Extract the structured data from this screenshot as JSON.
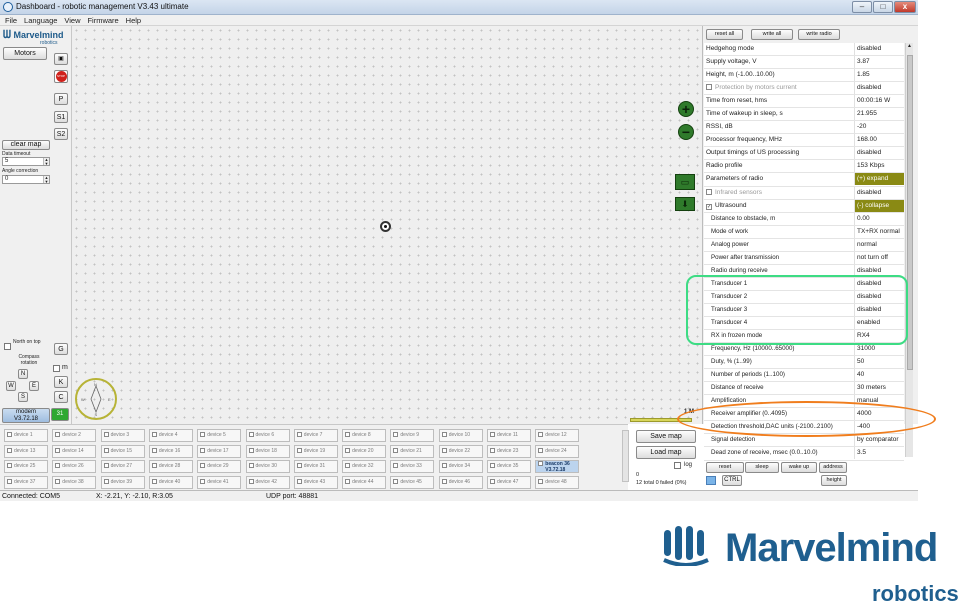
{
  "window": {
    "title": "Dashboard - robotic management  V3.43  ultimate",
    "minimize": "–",
    "maximize": "□",
    "close": "x"
  },
  "menu": [
    "File",
    "Language",
    "View",
    "Firmware",
    "Help"
  ],
  "left_panel": {
    "logo": "Marvelmind",
    "logo_sub": "robotics",
    "motors": "Motors",
    "clear_map": "clear map",
    "data_timeout_label": "Data timeout",
    "data_timeout_value": "5",
    "angle_correction_label": "Angle correction",
    "angle_correction_value": "0",
    "north_on_top": "North on top",
    "compass_rotation": "Compass rotation",
    "compass": {
      "n": "N",
      "w": "W",
      "e": "E",
      "s": "S"
    },
    "modem": "modem",
    "modem_version": "V3.72.18",
    "modem_id": "31",
    "side_buttons": {
      "stop": "STOP",
      "p": "P",
      "s1": "S1",
      "s2": "S2",
      "g": "G",
      "m": "m",
      "k": "K",
      "c": "C"
    }
  },
  "map": {
    "zoom_in": "+",
    "zoom_out": "−",
    "ruler": "1 M"
  },
  "right_panel": {
    "reset_all": "reset all",
    "write_all": "write all",
    "write_radio": "write radio",
    "properties": [
      {
        "name": "Hedgehog mode",
        "value": "disabled"
      },
      {
        "name": "Supply voltage, V",
        "value": "3.87"
      },
      {
        "name": "Height, m (-1.00..10.00)",
        "value": "1.85"
      },
      {
        "name": "Protection by motors current",
        "value": "disabled",
        "checkbox": true,
        "gray": true
      },
      {
        "name": "Time from reset, hms",
        "value": "00:00:16  W"
      },
      {
        "name": "Time of wakeup in sleep, s",
        "value": "21.955"
      },
      {
        "name": "RSSI, dB",
        "value": "-20"
      },
      {
        "name": "Processor frequency, MHz",
        "value": "168.00"
      },
      {
        "name": "Output timings of US processing",
        "value": "disabled"
      },
      {
        "name": "Radio profile",
        "value": "153 Kbps"
      },
      {
        "name": "Parameters of radio",
        "value": "(+) expand",
        "highlight": true
      },
      {
        "name": "Infrared sensors",
        "value": "disabled",
        "checkbox": true,
        "gray": true
      },
      {
        "name": "Ultrasound",
        "value": "(-) collapse",
        "checkbox": true,
        "checked": true,
        "highlight": true
      },
      {
        "name": "Distance to obstacle, m",
        "value": "0.00",
        "indent": true
      },
      {
        "name": "Mode of work",
        "value": "TX+RX normal",
        "indent": true
      },
      {
        "name": "Analog power",
        "value": "normal",
        "indent": true
      },
      {
        "name": "Power after transmission",
        "value": "not turn off",
        "indent": true
      },
      {
        "name": "Radio during receive",
        "value": "disabled",
        "indent": true
      },
      {
        "name": "Transducer 1",
        "value": "disabled",
        "indent": true
      },
      {
        "name": "Transducer 2",
        "value": "disabled",
        "indent": true
      },
      {
        "name": "Transducer 3",
        "value": "disabled",
        "indent": true
      },
      {
        "name": "Transducer 4",
        "value": "enabled",
        "indent": true
      },
      {
        "name": "RX in frozen mode",
        "value": "RX4",
        "indent": true
      },
      {
        "name": "Frequency, Hz (10000..65000)",
        "value": "31000",
        "indent": true
      },
      {
        "name": "Duty, % (1..99)",
        "value": "50",
        "indent": true
      },
      {
        "name": "Number of periods (1..100)",
        "value": "40",
        "indent": true
      },
      {
        "name": "Distance of receive",
        "value": "30 meters",
        "indent": true
      },
      {
        "name": "Amplification",
        "value": "manual",
        "indent": true
      },
      {
        "name": "Receiver amplifier (0..4095)",
        "value": "4000",
        "indent": true
      },
      {
        "name": "Detection threshold,DAC units (-2100..2100)",
        "value": "-400",
        "indent": true
      },
      {
        "name": "Signal detection",
        "value": "by comparator",
        "indent": true
      },
      {
        "name": "Dead zone of receive, msec (0.0..10.0)",
        "value": "3.5",
        "indent": true
      }
    ],
    "bottom_buttons": {
      "reset": "reset",
      "sleep": "sleep",
      "wake_up": "wake up",
      "address": "address",
      "ctrl": "CTRL",
      "height": "height"
    }
  },
  "devices": {
    "items": [
      "device 1",
      "device 2",
      "device 3",
      "device 4",
      "device 5",
      "device 6",
      "device 7",
      "device 8",
      "device 9",
      "device 10",
      "device 11",
      "device 12",
      "device 13",
      "device 14",
      "device 15",
      "device 16",
      "device 17",
      "device 18",
      "device 19",
      "device 20",
      "device 21",
      "device 22",
      "device 23",
      "device 24",
      "device 25",
      "device 26",
      "device 27",
      "device 28",
      "device 29",
      "device 30",
      "device 31",
      "device 32",
      "device 33",
      "device 34",
      "device 35",
      "beacon 36",
      "device 37",
      "device 38",
      "device 39",
      "device 40",
      "device 41",
      "device 42",
      "device 43",
      "device 44",
      "device 45",
      "device 46",
      "device 47",
      "device 48"
    ],
    "beacon_version": "V3.72.18",
    "save_map": "Save map",
    "load_map": "Load map",
    "log": "log",
    "summary_count": "0",
    "summary": "12 total  0 failed (0%)"
  },
  "status": {
    "connection": "Connected: COM5",
    "coords": "X: -2.21, Y: -2.10, R:3.05",
    "udp": "UDP port: 48881"
  },
  "brand": {
    "name": "Marvelmind",
    "sub": "robotics"
  }
}
